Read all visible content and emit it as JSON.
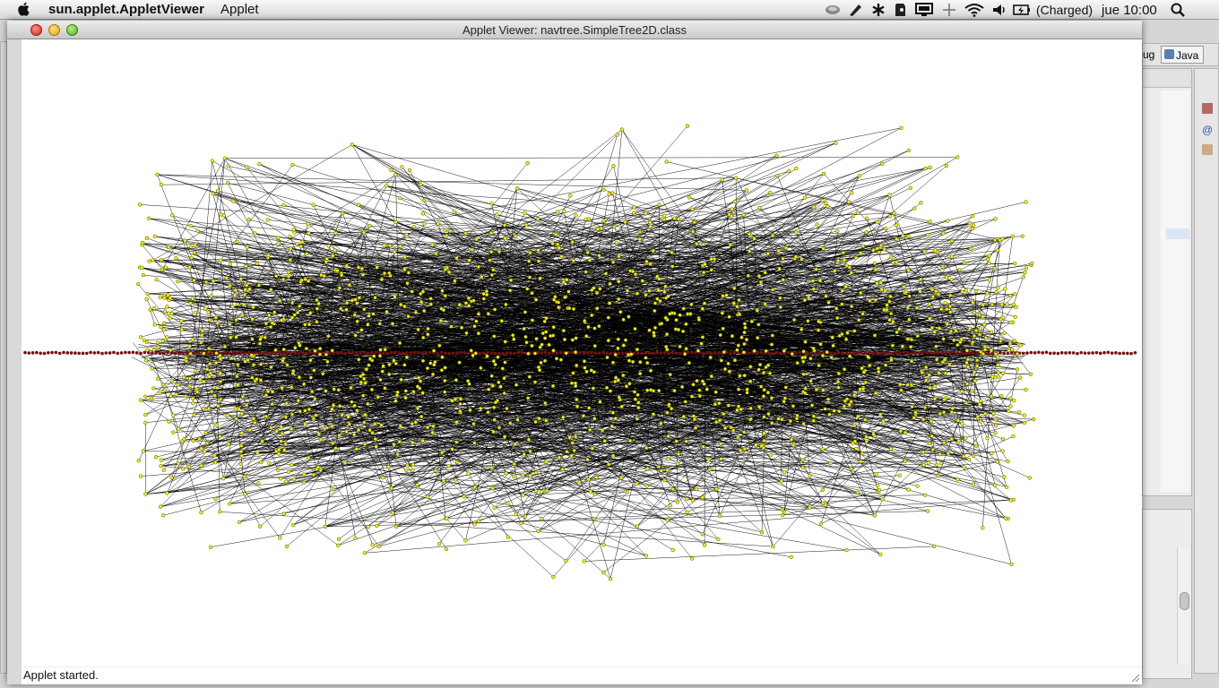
{
  "menubar": {
    "app_name": "sun.applet.AppletViewer",
    "menu_applet": "Applet",
    "battery_text": "(Charged)",
    "clock": "jue 10:00"
  },
  "window": {
    "title": "Applet Viewer: navtree.SimpleTree2D.class",
    "status": "Applet started."
  },
  "eclipse": {
    "perspective_debug": "ug",
    "perspective_java": "Java"
  },
  "colors": {
    "node_fill": "#f2f200",
    "node_stroke": "#555500",
    "axis_node": "#7a1010",
    "edge": "#000000"
  }
}
